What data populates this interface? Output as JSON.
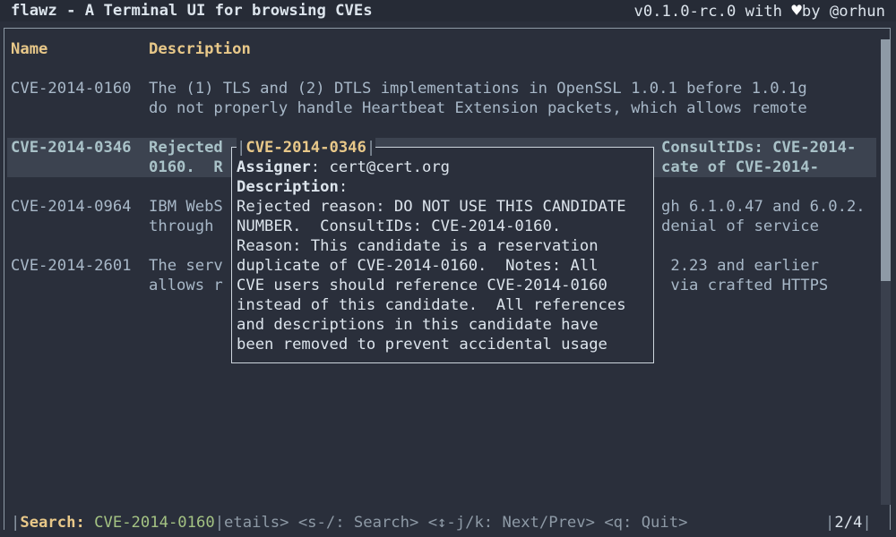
{
  "app": {
    "title": "flawz - A Terminal UI for browsing CVEs",
    "version_text": "v0.1.0-rc.0 with",
    "heart": "♥",
    "author_text": "by @orhun"
  },
  "table": {
    "headers": {
      "name": "Name",
      "description": "Description"
    },
    "rows": [
      {
        "name": "CVE-2014-0160",
        "desc_line1": "The (1) TLS and (2) DTLS implementations in OpenSSL 1.0.1 before 1.0.1g",
        "desc_line2": "do not properly handle Heartbeat Extension packets, which allows remote"
      },
      {
        "name": "CVE-2014-0346",
        "desc_line1_left": "Rejected",
        "desc_line1_right": "ConsultIDs: CVE-2014-",
        "desc_line2_left": "0160.  R",
        "desc_line2_right": "cate of CVE-2014-"
      },
      {
        "name": "CVE-2014-0964",
        "desc_line1_left": "IBM WebS",
        "desc_line1_right": "gh 6.1.0.47 and 6.0.2.",
        "desc_line2_left": "through ",
        "desc_line2_right": "denial of service"
      },
      {
        "name": "CVE-2014-2601",
        "desc_line1_left": "The serv",
        "desc_line1_right": " 2.23 and earlier",
        "desc_line2_left": "allows r",
        "desc_line2_right": " via crafted HTTPS"
      }
    ]
  },
  "popup": {
    "title": "CVE-2014-0346",
    "assigner_label": "Assigner",
    "assigner_value": ": cert@cert.org",
    "description_label": "Description",
    "description_colon": ":",
    "lines": [
      "Rejected reason: DO NOT USE THIS CANDIDATE",
      "NUMBER.  ConsultIDs: CVE-2014-0160.",
      "Reason: This candidate is a reservation",
      "duplicate of CVE-2014-0160.  Notes: All",
      "CVE users should reference CVE-2014-0160",
      "instead of this candidate.  All references",
      "and descriptions in this candidate have",
      "been removed to prevent accidental usage"
    ]
  },
  "footer": {
    "search_label": "Search:",
    "search_value": "CVE-2014-0160",
    "hints": "etails> <s-/: Search> <",
    "arrow": "↕",
    "hints2": "-j/k: Next/Prev> <q: Quit>",
    "page_indicator": "2/4"
  },
  "colors": {
    "background": "#2a2f3b",
    "header": "#e8c889",
    "text": "#a8b8c8",
    "selected_bg": "#3c4350",
    "search_value": "#a4c383"
  }
}
